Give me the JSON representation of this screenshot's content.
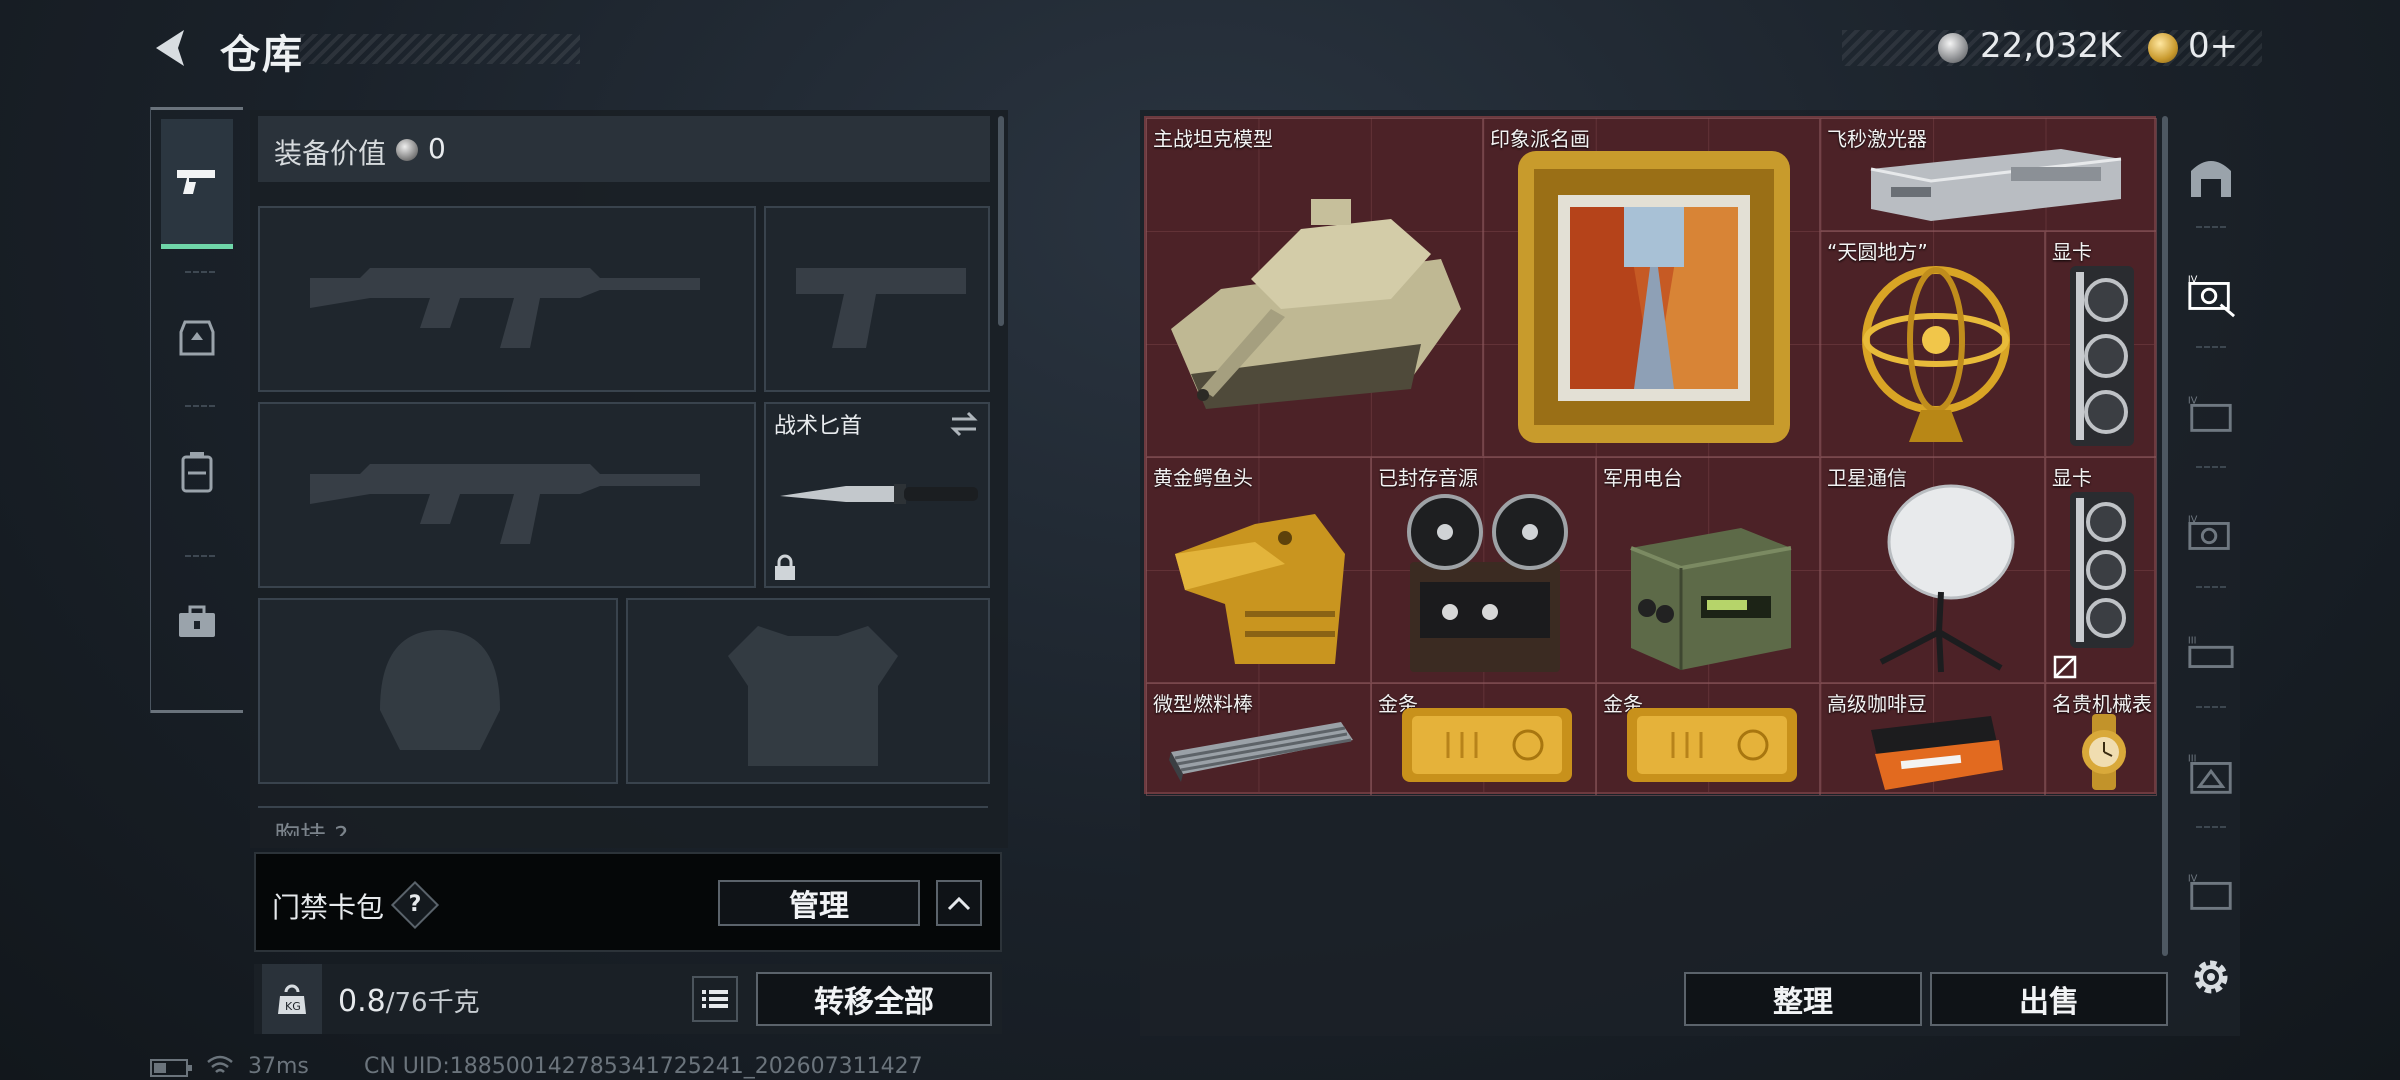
{
  "header": {
    "title": "仓库",
    "silver_amount": "22,032K",
    "gold_amount": "0+"
  },
  "loadout": {
    "equipment_value_label": "装备价值",
    "equipment_value": "0",
    "knife_label": "战术匕首",
    "partial_label": "胸挂 ?",
    "card_wallet_label": "门禁卡包",
    "help_mark": "?",
    "manage_button": "管理",
    "weight_current": "0.8",
    "weight_max": "/76千克",
    "transfer_all_button": "转移全部"
  },
  "stash": {
    "items": [
      {
        "label": "主战坦克模型"
      },
      {
        "label": "印象派名画"
      },
      {
        "label": "飞秒激光器"
      },
      {
        "label": "“天圆地方”"
      },
      {
        "label": "显卡"
      },
      {
        "label": "黄金鳄鱼头"
      },
      {
        "label": "已封存音源"
      },
      {
        "label": "军用电台"
      },
      {
        "label": "卫星通信"
      },
      {
        "label": "显卡"
      },
      {
        "label": "微型燃料棒"
      },
      {
        "label": "金条"
      },
      {
        "label": "金条"
      },
      {
        "label": "高级咖啡豆"
      },
      {
        "label": "名贵机械表"
      }
    ],
    "sort_button": "整理",
    "sell_button": "出售"
  },
  "status_bar": {
    "ping": "37ms",
    "uid": "CN UID:1885001427853417252​41_202607311427"
  },
  "colors": {
    "accent_green": "#6fd6a9",
    "stash_bg": "#4c2227"
  }
}
